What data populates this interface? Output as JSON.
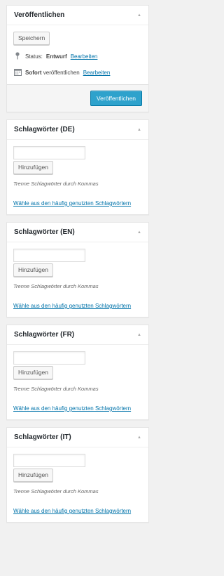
{
  "publish": {
    "title": "Veröffentlichen",
    "save_label": "Speichern",
    "status_label": "Status:",
    "status_value": "Entwurf",
    "edit_label": "Bearbeiten",
    "publish_when_bold": "Sofort",
    "publish_when_rest": "veröffentlichen",
    "publish_button": "Veröffentlichen",
    "colors": {
      "primary": "#2ea2cc",
      "link": "#0073aa"
    },
    "icons": {
      "toggle": "triangle-up-icon",
      "status": "pin-icon",
      "schedule": "calendar-icon"
    }
  },
  "tag_boxes": [
    {
      "title": "Schlagwörter (DE)",
      "input_value": "",
      "add_label": "Hinzufügen",
      "hint": "Trenne Schlagwörter durch Kommas",
      "cloud_link": "Wähle aus den häufig genutzten Schlagwörtern"
    },
    {
      "title": "Schlagwörter (EN)",
      "input_value": "",
      "add_label": "Hinzufügen",
      "hint": "Trenne Schlagwörter durch Kommas",
      "cloud_link": "Wähle aus den häufig genutzten Schlagwörtern"
    },
    {
      "title": "Schlagwörter (FR)",
      "input_value": "",
      "add_label": "Hinzufügen",
      "hint": "Trenne Schlagwörter durch Kommas",
      "cloud_link": "Wähle aus den häufig genutzten Schlagwörtern"
    },
    {
      "title": "Schlagwörter (IT)",
      "input_value": "",
      "add_label": "Hinzufügen",
      "hint": "Trenne Schlagwörter durch Kommas",
      "cloud_link": "Wähle aus den häufig genutzten Schlagwörtern"
    }
  ]
}
